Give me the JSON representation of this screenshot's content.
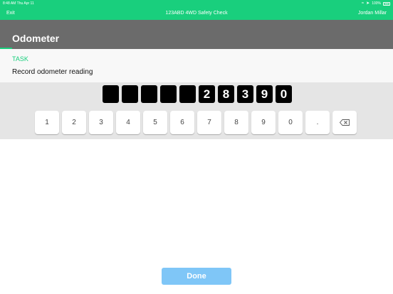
{
  "status_bar": {
    "time_date": "8:48 AM  Thu Apr 11",
    "battery": "100%"
  },
  "nav": {
    "exit_label": "Exit",
    "title": "123ABD 4WD Safety Check",
    "user": "Jordan Millar"
  },
  "header": {
    "title": "Odometer",
    "progress": 0.03
  },
  "task": {
    "label": "TASK",
    "text": "Record odometer reading"
  },
  "odometer_digits": [
    "",
    "",
    "",
    "",
    "",
    "2",
    "8",
    "3",
    "9",
    "0"
  ],
  "keypad_keys": [
    "1",
    "2",
    "3",
    "4",
    "5",
    "6",
    "7",
    "8",
    "9",
    "0",
    "."
  ],
  "backspace_icon": "backspace-icon",
  "done_label": "Done",
  "colors": {
    "accent": "#19cf7d",
    "header": "#6b6b6b",
    "done_button": "#7fc6f7"
  }
}
